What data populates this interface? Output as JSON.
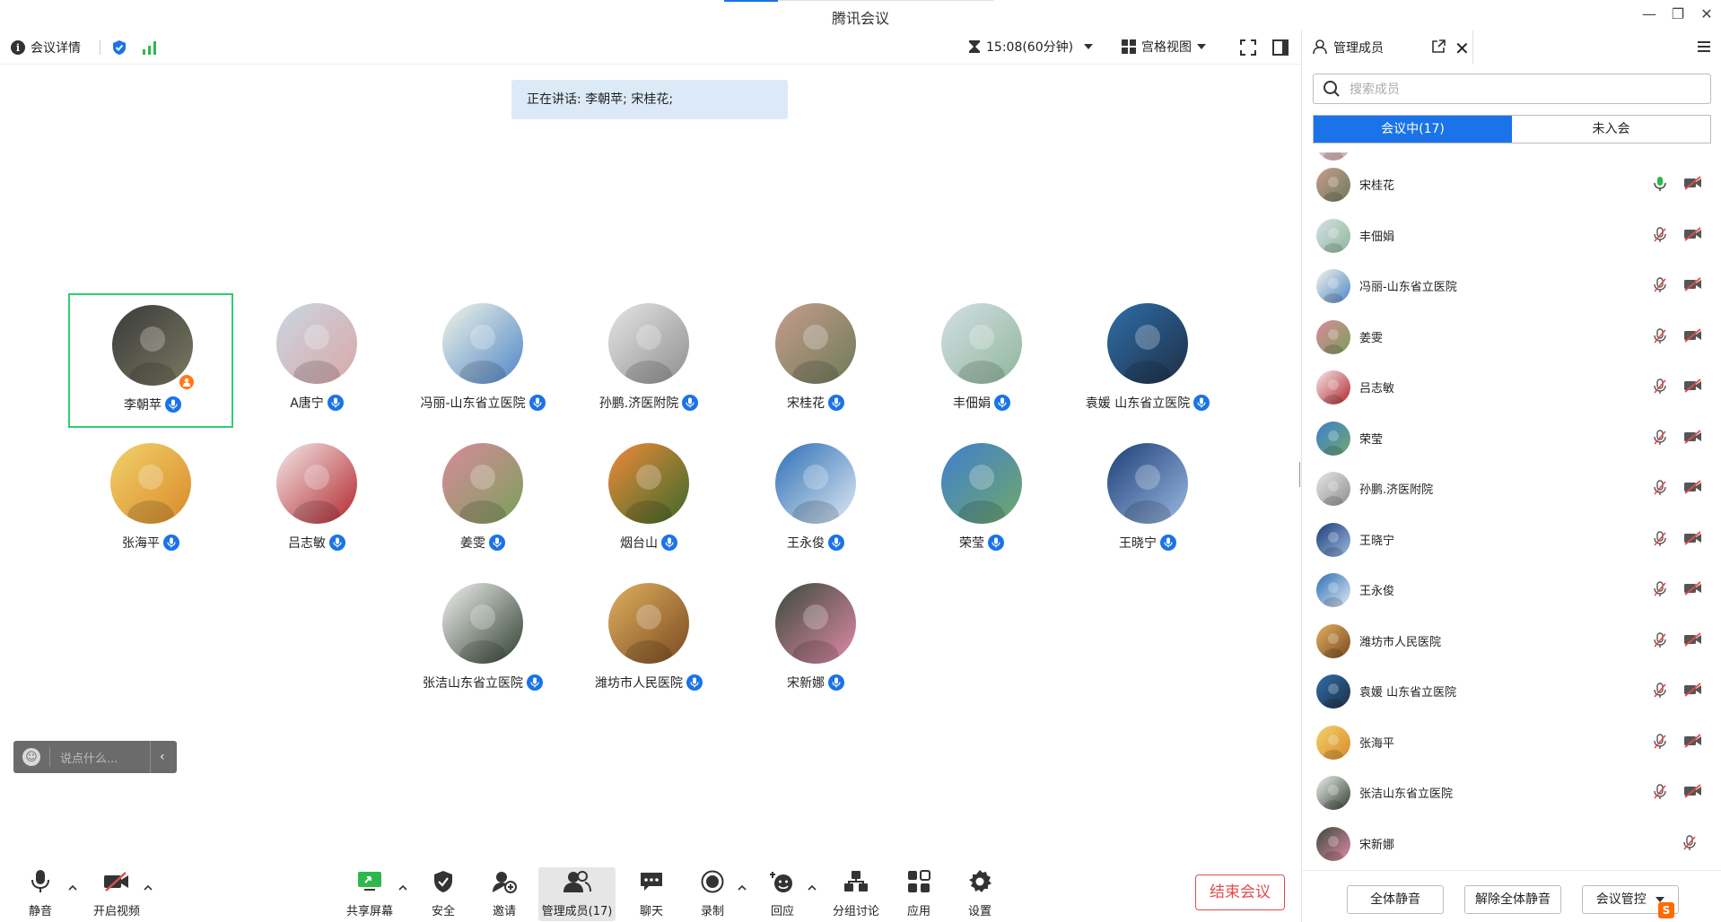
{
  "window": {
    "title": "腾讯会议"
  },
  "topbar": {
    "info_label": "会议详情",
    "timer": "15:08(60分钟)",
    "view_label": "宫格视图"
  },
  "speaking": {
    "text": "正在讲话: 李朝苹; 宋桂花;"
  },
  "participants": [
    {
      "name": "李朝苹",
      "host": true
    },
    {
      "name": "A唐宁"
    },
    {
      "name": "冯丽-山东省立医院"
    },
    {
      "name": "孙鹏.济医附院"
    },
    {
      "name": "宋桂花"
    },
    {
      "name": "丰佃娟"
    },
    {
      "name": "袁媛 山东省立医院"
    },
    {
      "name": "张海平"
    },
    {
      "name": "吕志敏"
    },
    {
      "name": "姜雯"
    },
    {
      "name": "烟台山"
    },
    {
      "name": "王永俊"
    },
    {
      "name": "荣莹"
    },
    {
      "name": "王晓宁"
    },
    {
      "name": "张洁山东省立医院"
    },
    {
      "name": "潍坊市人民医院"
    },
    {
      "name": "宋新娜"
    }
  ],
  "chat": {
    "placeholder": "说点什么..."
  },
  "toolbar": {
    "mute": "静音",
    "video": "开启视频",
    "share": "共享屏幕",
    "security": "安全",
    "invite": "邀请",
    "members": "管理成员(17)",
    "chat": "聊天",
    "record": "录制",
    "react": "回应",
    "breakout": "分组讨论",
    "apps": "应用",
    "settings": "设置",
    "end": "结束会议"
  },
  "panel": {
    "title": "管理成员",
    "search_placeholder": "搜索成员",
    "tab_in": "会议中(17)",
    "tab_out": "未入会",
    "members": [
      {
        "name": "宋桂花",
        "mic": "on"
      },
      {
        "name": "丰佃娟",
        "mic": "off"
      },
      {
        "name": "冯丽-山东省立医院",
        "mic": "off"
      },
      {
        "name": "姜雯",
        "mic": "off"
      },
      {
        "name": "吕志敏",
        "mic": "off"
      },
      {
        "name": "荣莹",
        "mic": "off"
      },
      {
        "name": "孙鹏.济医附院",
        "mic": "off"
      },
      {
        "name": "王晓宁",
        "mic": "off"
      },
      {
        "name": "王永俊",
        "mic": "off"
      },
      {
        "name": "潍坊市人民医院",
        "mic": "off"
      },
      {
        "name": "袁媛 山东省立医院",
        "mic": "off"
      },
      {
        "name": "张海平",
        "mic": "off"
      },
      {
        "name": "张洁山东省立医院",
        "mic": "off"
      },
      {
        "name": "宋新娜",
        "mic": "off"
      }
    ],
    "mute_all": "全体静音",
    "unmute_all": "解除全体静音",
    "control": "会议管控"
  },
  "colors": {
    "accent": "#1a73e8",
    "active_border": "#2ecc71",
    "end": "#e34b4b"
  }
}
